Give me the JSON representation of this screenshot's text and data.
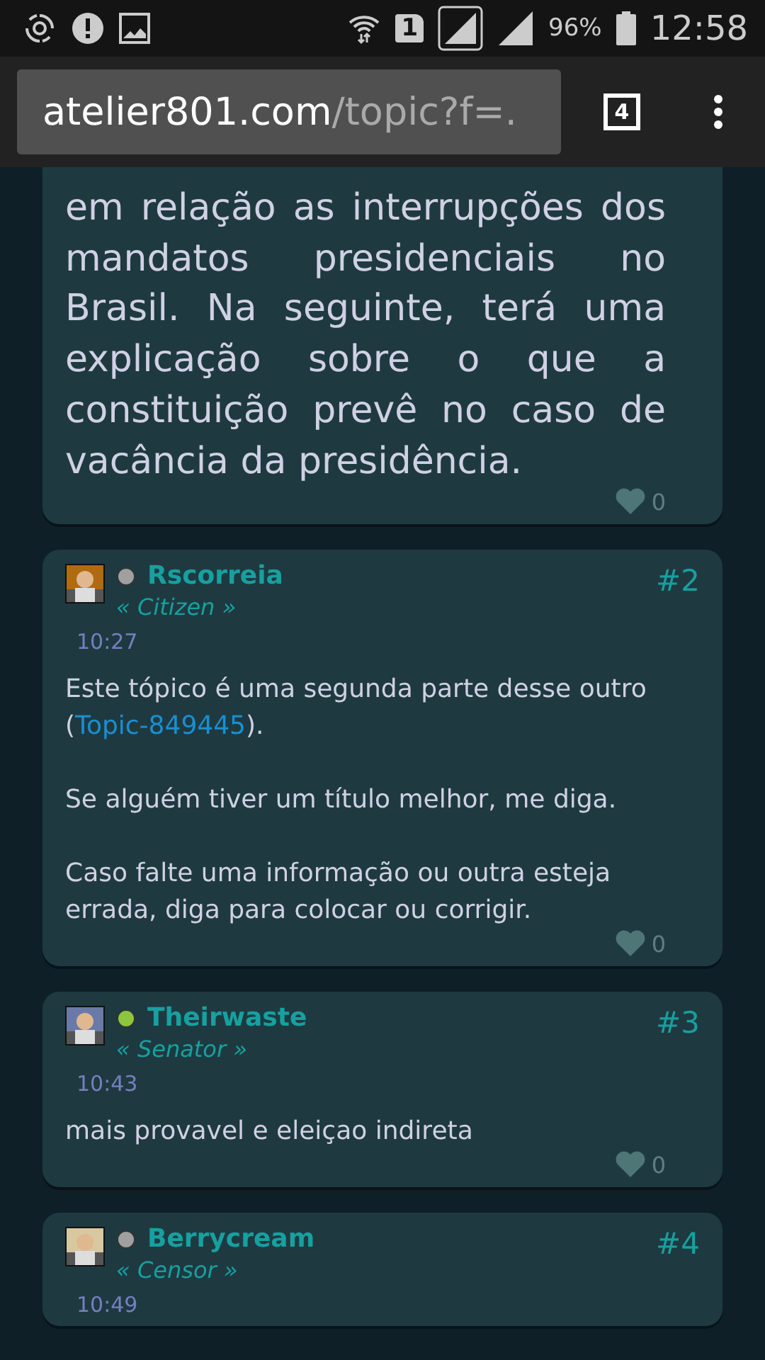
{
  "status_bar": {
    "battery": "96%",
    "time": "12:58",
    "sim": "1"
  },
  "browser": {
    "url_host": "atelier801.com",
    "url_path": "/topic?f=.",
    "tab_count": "4"
  },
  "first_post": {
    "body": "em relação as interrupções dos mandatos presidenciais no Brasil. Na seguinte, terá uma explicação sobre o que a constituição prevê no caso de vacância da presidência.",
    "likes": "0"
  },
  "posts": [
    {
      "author": "Rscorreia",
      "online": false,
      "rank": "« Citizen »",
      "time": "10:27",
      "number": "#2",
      "likes": "0",
      "paragraphs": [
        [
          {
            "kind": "text",
            "text": "Este tópico é uma segunda parte desse outro ("
          },
          {
            "kind": "link",
            "text": "Topic-849445"
          },
          {
            "kind": "text",
            "text": ")."
          }
        ],
        [
          {
            "kind": "text",
            "text": "Se alguém tiver um título melhor, me diga."
          }
        ],
        [
          {
            "kind": "text",
            "text": "Caso falte uma informação ou outra esteja errada, diga para colocar ou corrigir."
          }
        ]
      ]
    },
    {
      "author": "Theirwaste",
      "online": true,
      "rank": "« Senator »",
      "time": "10:43",
      "number": "#3",
      "likes": "0",
      "paragraphs": [
        [
          {
            "kind": "text",
            "text": "mais provavel e eleiçao indireta"
          }
        ]
      ]
    },
    {
      "author": "Berrycream",
      "online": false,
      "rank": "« Censor »",
      "time": "10:49",
      "number": "#4"
    }
  ]
}
